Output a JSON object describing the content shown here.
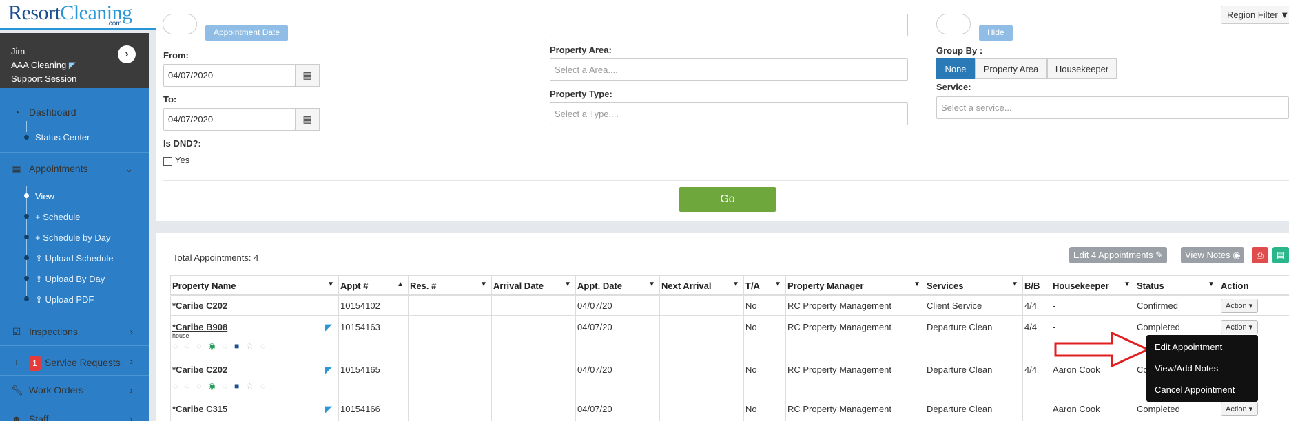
{
  "header": {
    "logo_main": "Resort",
    "logo_accent": "Cleaning",
    "logo_sub": ".com",
    "region_filter": "Region Filter"
  },
  "sidebar": {
    "user_name": "Jim",
    "company": "AAA Cleaning",
    "session": "Support Session",
    "items": [
      {
        "label": "Dashboard",
        "icon": "dashboard-icon"
      },
      {
        "label": "Status Center"
      },
      {
        "label": "Appointments",
        "icon": "calendar-icon"
      },
      {
        "label": "View"
      },
      {
        "label": "Schedule"
      },
      {
        "label": "Schedule by Day"
      },
      {
        "label": "Upload Schedule"
      },
      {
        "label": "Upload By Day"
      },
      {
        "label": "Upload PDF"
      },
      {
        "label": "Inspections",
        "icon": "clipboard-check-icon"
      },
      {
        "label": "Service Requests",
        "badge": "1"
      },
      {
        "label": "Work Orders",
        "icon": "wrench-icon"
      },
      {
        "label": "Staff",
        "icon": "users-icon"
      }
    ]
  },
  "filters": {
    "appointment_date_btn": "Appointment Date",
    "hide_btn": "Hide",
    "from_label": "From:",
    "from_value": "04/07/2020",
    "to_label": "To:",
    "to_value": "04/07/2020",
    "dnd_label": "Is DND?:",
    "dnd_yes": "Yes",
    "area_label": "Property Area:",
    "area_placeholder": "Select a Area....",
    "type_label": "Property Type:",
    "type_placeholder": "Select a Type....",
    "group_label": "Group By :",
    "group_options": [
      "None",
      "Property Area",
      "Housekeeper"
    ],
    "service_label": "Service:",
    "service_placeholder": "Select a service...",
    "go": "Go"
  },
  "results": {
    "total": "Total Appointments: 4",
    "edit_btn": "Edit 4 Appointments",
    "notes_btn": "View Notes",
    "columns": [
      "Property Name",
      "Appt #",
      "Res. #",
      "Arrival Date",
      "Appt. Date",
      "Next Arrival",
      "T/A",
      "Property Manager",
      "Services",
      "B/B",
      "Housekeeper",
      "Status",
      "Action"
    ],
    "rows": [
      {
        "name": "*Caribe C202",
        "sub": "",
        "appt": "10154102",
        "res": "",
        "arrival": "",
        "date": "04/07/20",
        "next": "",
        "ta": "No",
        "pm": "RC Property Management",
        "service": "Client Service",
        "bb": "4/4",
        "hk": "-",
        "status": "Confirmed",
        "action": "Action"
      },
      {
        "name": "*Caribe B908",
        "sub": "house",
        "appt": "10154163",
        "res": "",
        "arrival": "",
        "date": "04/07/20",
        "next": "",
        "ta": "No",
        "pm": "RC Property Management",
        "service": "Departure Clean",
        "bb": "4/4",
        "hk": "-",
        "status": "Completed",
        "action": "Action"
      },
      {
        "name": "*Caribe C202",
        "sub": "",
        "appt": "10154165",
        "res": "",
        "arrival": "",
        "date": "04/07/20",
        "next": "",
        "ta": "No",
        "pm": "RC Property Management",
        "service": "Departure Clean",
        "bb": "4/4",
        "hk": "Aaron Cook",
        "status": "Co",
        "action": "Action"
      },
      {
        "name": "*Caribe C315",
        "sub": "",
        "appt": "10154166",
        "res": "",
        "arrival": "",
        "date": "04/07/20",
        "next": "",
        "ta": "No",
        "pm": "RC Property Management",
        "service": "Departure Clean",
        "bb": "",
        "hk": "Aaron Cook",
        "status": "Completed",
        "action": "Action"
      }
    ]
  },
  "menu": {
    "items": [
      "Edit Appointment",
      "View/Add Notes",
      "Cancel Appointment"
    ]
  },
  "colors": {
    "sidebar": "#2c7fc7",
    "accent": "#2a96d6",
    "go": "#6ea83c",
    "arrow": "#e02020"
  }
}
